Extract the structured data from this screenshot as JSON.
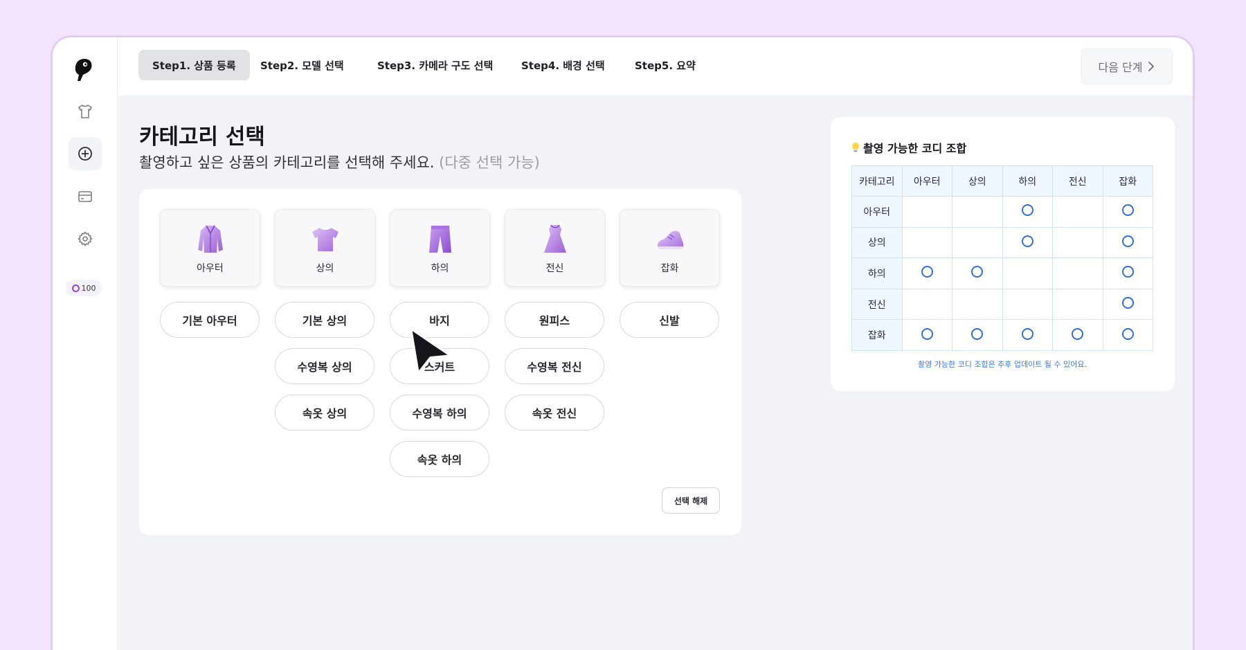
{
  "credit": "100",
  "topbar": {
    "tabs": [
      {
        "label": "Step1. 상품 등록"
      },
      {
        "label": "Step2. 모델 선택"
      },
      {
        "label": "Step3. 카메라 구도 선택"
      },
      {
        "label": "Step4. 배경 선택"
      },
      {
        "label": "Step5. 요약"
      }
    ],
    "active_tab": 0,
    "next_label": "다음 단계",
    "next_icon": "chevron-right-icon"
  },
  "sidebar": {
    "items": [
      {
        "icon": "tshirt-icon"
      },
      {
        "icon": "plus-circle-icon",
        "active": true
      },
      {
        "icon": "card-icon"
      },
      {
        "icon": "gear-icon"
      }
    ]
  },
  "main": {
    "title": "카테고리 선택",
    "subtitle": "촬영하고 싶은 상품의 카테고리를 선택해 주세요.",
    "subtitle_note": "(다중 선택 가능)",
    "categories": [
      {
        "label": "아우터",
        "icon": "coat-icon",
        "options": [
          "기본 아우터"
        ]
      },
      {
        "label": "상의",
        "icon": "tshirt-icon",
        "options": [
          "기본 상의",
          "수영복 상의",
          "속옷 상의"
        ]
      },
      {
        "label": "하의",
        "icon": "pants-icon",
        "options": [
          "바지",
          "스커트",
          "수영복 하의",
          "속옷 하의"
        ]
      },
      {
        "label": "전신",
        "icon": "dress-icon",
        "options": [
          "원피스",
          "수영복 전신",
          "속옷 전신"
        ]
      },
      {
        "label": "잡화",
        "icon": "shoe-icon",
        "options": [
          "신발"
        ]
      }
    ],
    "deselect_label": "선택 해제"
  },
  "combo": {
    "title": "촬영 가능한 코디 조합",
    "icon": "lightbulb-icon",
    "header": [
      "카테고리",
      "아우터",
      "상의",
      "하의",
      "전신",
      "잡화"
    ],
    "rows": [
      {
        "label": "아우터",
        "marks": [
          false,
          false,
          true,
          false,
          true
        ]
      },
      {
        "label": "상의",
        "marks": [
          false,
          false,
          true,
          false,
          true
        ]
      },
      {
        "label": "하의",
        "marks": [
          true,
          true,
          false,
          false,
          true
        ]
      },
      {
        "label": "전신",
        "marks": [
          false,
          false,
          false,
          false,
          true
        ]
      },
      {
        "label": "잡화",
        "marks": [
          true,
          true,
          true,
          true,
          true
        ]
      }
    ],
    "note": "촬영 가능한 코디 조합은 추후 업데이트 될 수 있어요.",
    "accent": "#2f6fe0"
  },
  "colors": {
    "background": "#f1e4fb",
    "brand_purple": "#9b43d6",
    "main_bg": "#f2f3f6"
  }
}
